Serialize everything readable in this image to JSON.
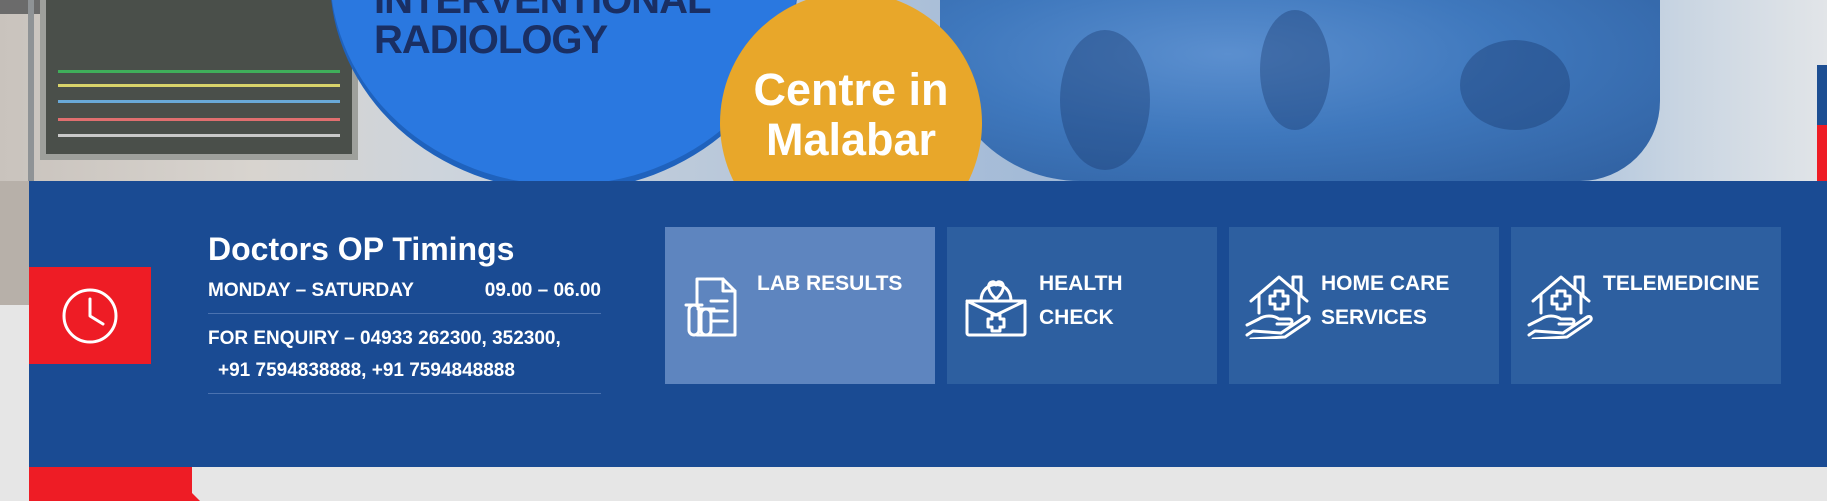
{
  "banner": {
    "blue_circle_line1": "INTERVENTIONAL",
    "blue_circle_line2": "RADIOLOGY",
    "orange_circle_line1": "Centre in",
    "orange_circle_line2": "Malabar"
  },
  "timings": {
    "heading": "Doctors OP Timings",
    "days": "MONDAY – SATURDAY",
    "hours": "09.00 – 06.00",
    "enquiry_line1": "FOR ENQUIRY – 04933 262300, 352300,",
    "enquiry_line2": "+91 7594838888, +91 7594848888",
    "icon": "clock-icon"
  },
  "services": [
    {
      "icon": "lab-results-icon",
      "line1": "LAB RESULTS",
      "line2": ""
    },
    {
      "icon": "health-check-icon",
      "line1": "HEALTH",
      "line2": "CHECK"
    },
    {
      "icon": "home-care-icon",
      "line1": "HOME CARE",
      "line2": "SERVICES"
    },
    {
      "icon": "telemedicine-icon",
      "line1": "TELEMEDICINE",
      "line2": ""
    }
  ],
  "colors": {
    "panel": "#1a4b93",
    "accent_red": "#ee1c25",
    "tile": "#2d5fa0",
    "tile_active": "#5e85bf",
    "banner_blue": "#2a78e0",
    "banner_orange": "#e8a72a"
  },
  "social_strip_colors": [
    "#1d4e92",
    "#ee1c25",
    "#1fbf4a",
    "#36509a",
    "#b4141f",
    "#d94f8e"
  ]
}
